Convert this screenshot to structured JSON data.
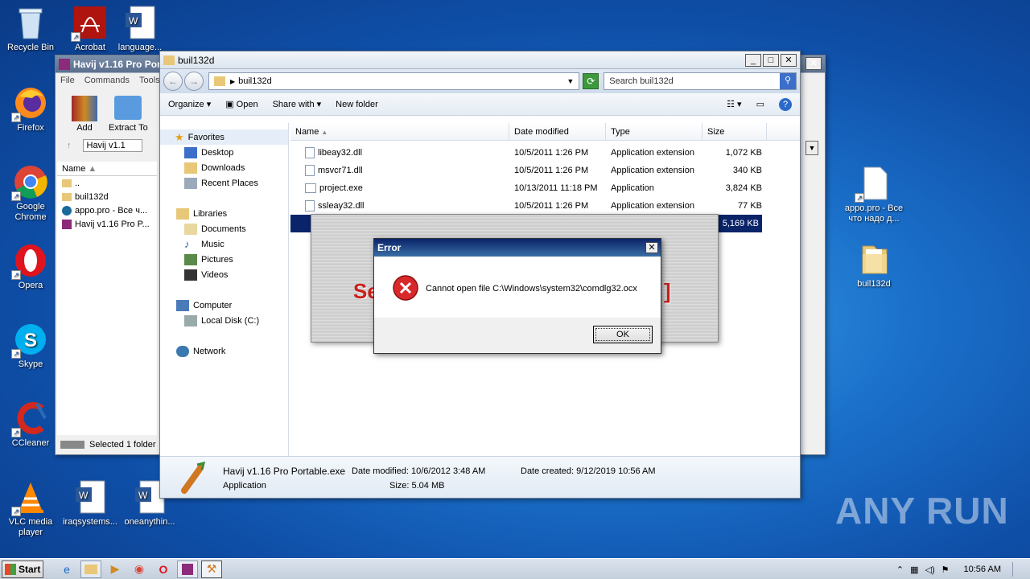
{
  "desktop": {
    "icons": [
      {
        "label": "Recycle Bin"
      },
      {
        "label": "Acrobat"
      },
      {
        "label": "language..."
      },
      {
        "label": "Firefox"
      },
      {
        "label": "Google Chrome"
      },
      {
        "label": "Opera"
      },
      {
        "label": "Skype"
      },
      {
        "label": "CCleaner"
      },
      {
        "label": "VLC media player"
      },
      {
        "label": "iraqsystems..."
      },
      {
        "label": "oneanythin..."
      },
      {
        "label": "appo.pro - Все что надо д..."
      },
      {
        "label": "buil132d"
      }
    ]
  },
  "rar_window": {
    "title": "Havij v1.16 Pro Por",
    "menu": [
      "File",
      "Commands",
      "Tools"
    ],
    "tools": {
      "add": "Add",
      "extract": "Extract To"
    },
    "path": "Havij v1.1",
    "col_name": "Name",
    "items": [
      "..",
      "buil132d",
      "appo.pro - Все ч...",
      "Havij v1.16 Pro P..."
    ],
    "status": "Selected 1 folder"
  },
  "explorer": {
    "title": "buil132d",
    "address": "buil132d",
    "search_placeholder": "Search buil132d",
    "toolbar": {
      "organize": "Organize",
      "open": "Open",
      "share": "Share with",
      "new_folder": "New folder"
    },
    "nav": {
      "favorites": "Favorites",
      "fav_items": [
        "Desktop",
        "Downloads",
        "Recent Places"
      ],
      "libraries": "Libraries",
      "lib_items": [
        "Documents",
        "Music",
        "Pictures",
        "Videos"
      ],
      "computer": "Computer",
      "comp_items": [
        "Local Disk (C:)"
      ],
      "network": "Network"
    },
    "columns": {
      "name": "Name",
      "date": "Date modified",
      "type": "Type",
      "size": "Size"
    },
    "files": [
      {
        "name": "libeay32.dll",
        "date": "10/5/2011 1:26 PM",
        "type": "Application extension",
        "size": "1,072 KB"
      },
      {
        "name": "msvcr71.dll",
        "date": "10/5/2011 1:26 PM",
        "type": "Application extension",
        "size": "340 KB"
      },
      {
        "name": "project.exe",
        "date": "10/13/2011 11:18 PM",
        "type": "Application",
        "size": "3,824 KB"
      },
      {
        "name": "ssleay32.dll",
        "date": "10/5/2011 1:26 PM",
        "type": "Application extension",
        "size": "77 KB"
      }
    ],
    "selected_size": "5,169 KB",
    "details": {
      "filename": "Havij v1.16 Pro Portable.exe",
      "modified": "Date modified: 10/6/2012 3:48 AM",
      "created": "Date created: 9/12/2019 10:56 AM",
      "type": "Application",
      "size": "Size: 5.04 MB"
    }
  },
  "error": {
    "title": "Error",
    "message": "Cannot open file C:\\Windows\\system32\\comdlg32.ocx",
    "ok": "OK"
  },
  "taskbar": {
    "start": "Start",
    "time": "10:56 AM"
  },
  "watermark": "ANY RUN"
}
